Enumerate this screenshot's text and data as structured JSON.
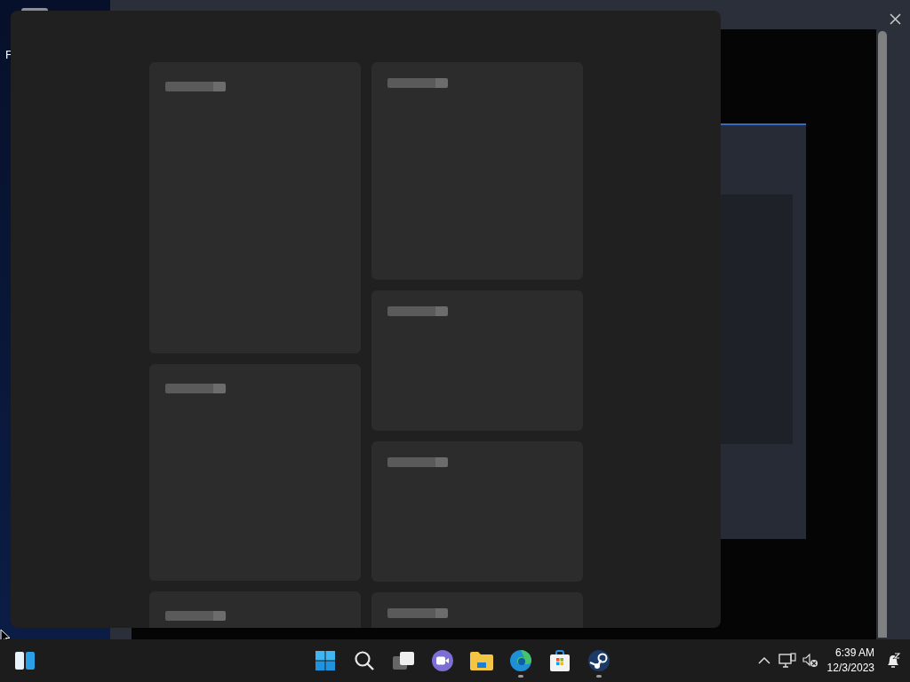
{
  "desktop": {
    "icon_label": "F"
  },
  "background_window": {
    "scrollbar": true
  },
  "widgets_panel": {
    "loading": true,
    "columns": [
      {
        "cards": [
          {
            "kind": "large"
          },
          {
            "kind": "medium"
          },
          {
            "kind": "partial"
          }
        ]
      },
      {
        "cards": [
          {
            "kind": "medium_short"
          },
          {
            "kind": "small"
          },
          {
            "kind": "small"
          },
          {
            "kind": "partial"
          }
        ]
      }
    ]
  },
  "taskbar": {
    "left": [
      {
        "kind": "widgets"
      }
    ],
    "apps": [
      {
        "kind": "start",
        "running": false
      },
      {
        "kind": "search",
        "running": false
      },
      {
        "kind": "taskview",
        "running": false
      },
      {
        "kind": "chat",
        "running": false
      },
      {
        "kind": "explorer",
        "running": false
      },
      {
        "kind": "edge",
        "running": true
      },
      {
        "kind": "store",
        "running": false
      },
      {
        "kind": "steam",
        "running": true
      }
    ],
    "tray": [
      {
        "kind": "chevron"
      },
      {
        "kind": "network"
      },
      {
        "kind": "volume_muted"
      }
    ],
    "clock": {
      "time": "6:39 AM",
      "date": "12/3/2023"
    },
    "notifications": {
      "do_not_disturb": true
    }
  }
}
